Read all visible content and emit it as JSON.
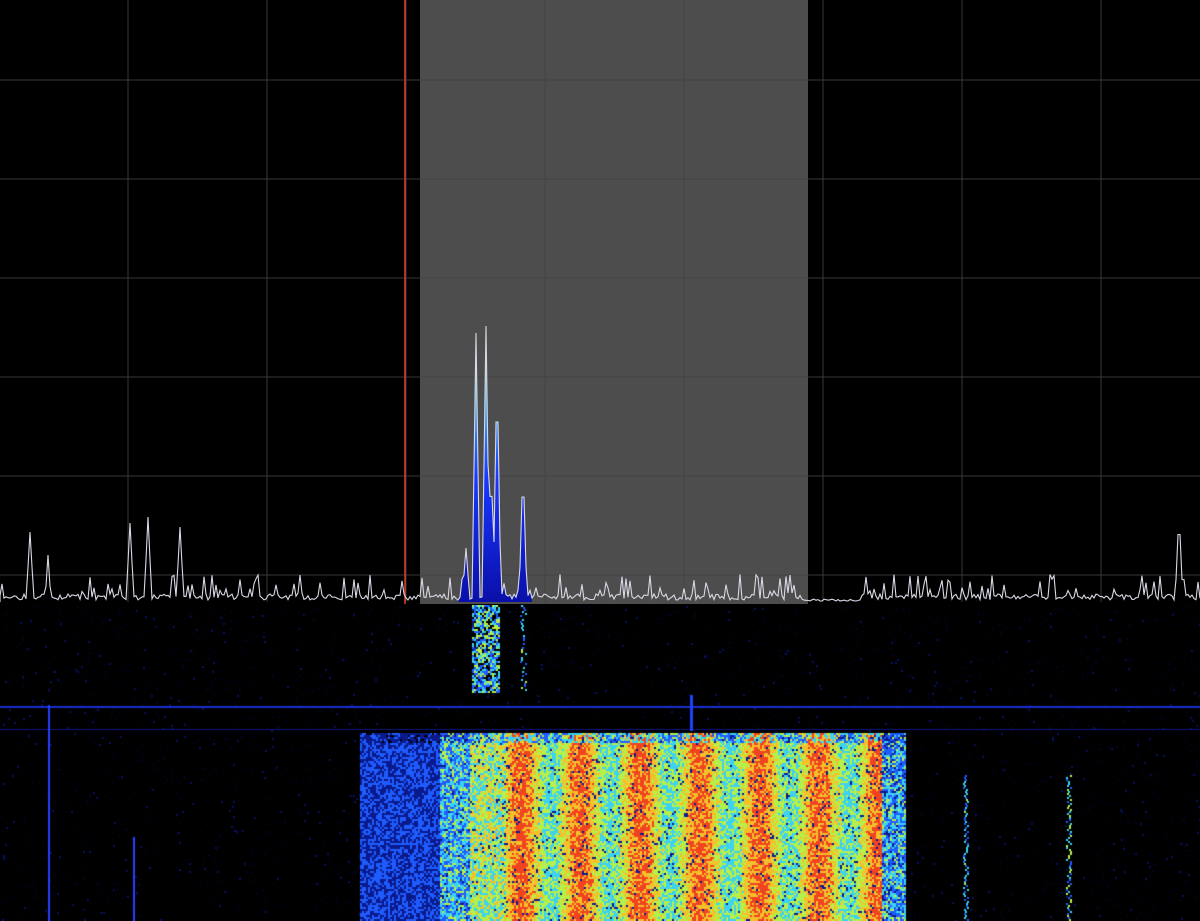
{
  "app": {
    "view": "spectrum-and-waterfall"
  },
  "colors": {
    "background": "#000000",
    "grid": "#3a3a3a",
    "filter_band": "#4d4d4d",
    "tuning_marker": "#e53b2a",
    "trace": "#d9d9e6",
    "waterfall_palette": [
      "#00000a",
      "#0a1a8c",
      "#1f5cff",
      "#3cd2f0",
      "#b6f04a",
      "#f5c02a",
      "#f04420"
    ]
  },
  "spectrum": {
    "grid": true,
    "filter_band_visible": true,
    "tuning_marker_visible": true
  },
  "waterfall": {
    "visible": true
  }
}
